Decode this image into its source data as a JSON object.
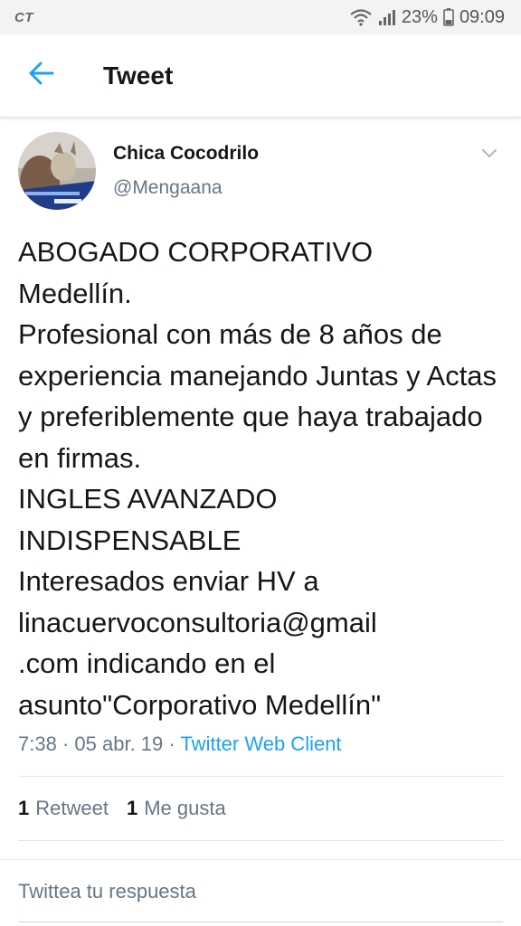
{
  "status_bar": {
    "carrier": "CT",
    "battery": "23%",
    "time": "09:09"
  },
  "app_bar": {
    "title": "Tweet",
    "back_icon": "arrow-left-icon"
  },
  "tweet": {
    "display_name": "Chica Cocodrilo",
    "handle": "@Mengaana",
    "text": "ABOGADO CORPORATIVO\nMedellín.\nProfesional con más de 8 años de experiencia manejando Juntas y Actas y preferiblemente que haya trabajado en firmas.\nINGLES AVANZADO\nINDISPENSABLE\nInteresados enviar HV a linacuervoconsultoria@gmail\n.com indicando en el asunto\"Corporativo Medellín\"",
    "time": "7:38",
    "date": "05 abr. 19",
    "separator": "·",
    "client": "Twitter Web Client",
    "retweet_count": "1",
    "retweet_label": "Retweet",
    "like_count": "1",
    "like_label": "Me gusta"
  },
  "reply": {
    "placeholder": "Twittea tu respuesta"
  },
  "colors": {
    "accent": "#1da1f2",
    "secondary_text": "#657786",
    "primary_text": "#14171a"
  }
}
